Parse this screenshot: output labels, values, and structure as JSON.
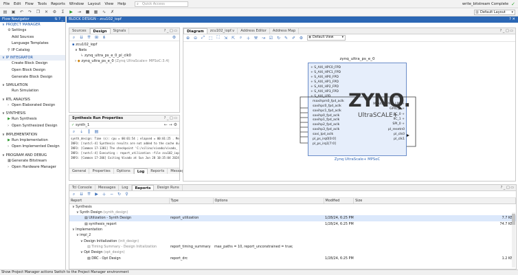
{
  "menu": {
    "items": [
      "File",
      "Edit",
      "Flow",
      "Tools",
      "Reports",
      "Window",
      "Layout",
      "View",
      "Help"
    ],
    "quick_access_placeholder": "Quick Access"
  },
  "status": {
    "right": "write_bitstream Complete"
  },
  "layout": {
    "selected": "Default Layout"
  },
  "flow_navigator": {
    "title": "Flow Navigator",
    "sections": [
      {
        "label": "PROJECT MANAGER",
        "items": [
          "Settings",
          "Add Sources",
          "Language Templates",
          "IP Catalog"
        ]
      },
      {
        "label": "IP INTEGRATOR",
        "items": [
          "Create Block Design",
          "Open Block Design",
          "Generate Block Design"
        ]
      },
      {
        "label": "SIMULATION",
        "items": [
          "Run Simulation"
        ]
      },
      {
        "label": "RTL ANALYSIS",
        "items": [
          "Open Elaborated Design"
        ]
      },
      {
        "label": "SYNTHESIS",
        "items": [
          "Run Synthesis",
          "Open Synthesized Design"
        ]
      },
      {
        "label": "IMPLEMENTATION",
        "items": [
          "Run Implementation",
          "Open Implemented Design"
        ]
      },
      {
        "label": "PROGRAM AND DEBUG",
        "items": [
          "Generate Bitstream",
          "Open Hardware Manager"
        ]
      }
    ]
  },
  "block_design": {
    "title": "BLOCK DESIGN - zcu102_iopf"
  },
  "sources_panel": {
    "tabs": [
      "Sources",
      "Design",
      "Signals"
    ],
    "root": "zcu102_iopf",
    "nets_label": "Nets",
    "nodes": [
      {
        "name": "zynq_ultra_ps_e_0_pl_clk0"
      },
      {
        "name": "zynq_ultra_ps_e_0",
        "detail": "(Zynq UltraScale+ MPSoC:3.4)"
      }
    ]
  },
  "synth_panel": {
    "title": "Synthesis Run Properties",
    "run": "synth_1",
    "log": [
      "synth_design: Time (s): cpu = 00:01:54 ; elapsed = 00:01:25 . Mem",
      "INFO: [runtcl-4] Synthesis results are not added to the cache due",
      "INFO: [Common 17-1381] The checkpoint 'C:/xilinx/vivado/vivado_",
      "INFO: [runtcl-4] Executing : report_utilization -file zcu102_iopf",
      "INFO: [Common 17-206] Exiting Vivado at Sun Jun 28 10:35:04 2024."
    ],
    "tabs": [
      "General",
      "Properties",
      "Options",
      "Log",
      "Reports",
      "Messages"
    ]
  },
  "diagram_panel": {
    "tabs": [
      "Diagram",
      "zcu102_iopf.v",
      "Address Editor",
      "Address Map"
    ],
    "view_selector": "Default View",
    "ip": {
      "name": "zynq_ultra_ps_e_0",
      "left_ports": [
        "S_AXI_HPC0_FPD",
        "S_AXI_HPC1_FPD",
        "S_AXI_HP0_FPD",
        "S_AXI_HP1_FPD",
        "S_AXI_HP2_FPD",
        "S_AXI_HP3_FPD",
        "S_AXI_LPD",
        "maxihpm0_fpd_aclk",
        "saxihpc0_fpd_aclk",
        "saxihpc1_fpd_aclk",
        "saxihp0_fpd_aclk",
        "saxihp1_fpd_aclk",
        "saxihp2_fpd_aclk",
        "saxihp3_fpd_aclk",
        "saxi_lpd_aclk",
        "pl_ps_irq0[0:0]",
        "pl_ps_irq1[7:0]"
      ],
      "right_ports": [
        "M_AXI_HPM0_LPD",
        "GPIO_0",
        "IIC_0",
        "IIC_1",
        "SPI_0",
        "pl_resetn0",
        "pl_clk0",
        "pl_clk1"
      ],
      "logo_main": "ZYNQ.",
      "logo_sub": "UltraSCALE+",
      "footer": "Zynq UltraScale+ MPSoC"
    }
  },
  "bottom_panel": {
    "tabs": [
      "Tcl Console",
      "Messages",
      "Log",
      "Reports",
      "Design Runs"
    ],
    "columns": [
      "Report",
      "Type",
      "Options",
      "Modified",
      "Size"
    ],
    "rows": [
      {
        "report": "Synthesis",
        "type": "",
        "options": "",
        "modified": "",
        "size": ""
      },
      {
        "report": "Synth Design",
        "note": "(synth_design)",
        "type": "",
        "options": "",
        "modified": "",
        "size": ""
      },
      {
        "report": "Utilization - Synth Design",
        "type": "report_utilization",
        "options": "",
        "modified": "1/28/24, 6:25 PM",
        "size": "7.7 KB"
      },
      {
        "report": "synthesis_report",
        "type": "",
        "options": "",
        "modified": "1/28/24, 6:25 PM",
        "size": "74.7 KB"
      },
      {
        "report": "Implementation",
        "type": "",
        "options": "",
        "modified": "",
        "size": ""
      },
      {
        "report": "impl_2",
        "type": "",
        "options": "",
        "modified": "",
        "size": ""
      },
      {
        "report": "Design Initialization",
        "note": "(init_design)",
        "type": "",
        "options": "",
        "modified": "",
        "size": ""
      },
      {
        "report": "Timing Summary - Design Initialization",
        "type": "report_timing_summary",
        "options": "max_paths = 10, report_unconstrained = true;",
        "modified": "",
        "size": ""
      },
      {
        "report": "Opt Design",
        "note": "(opt_design)",
        "type": "",
        "options": "",
        "modified": "",
        "size": ""
      },
      {
        "report": "DRC - Opt Design",
        "type": "report_drc",
        "options": "",
        "modified": "1/28/24, 6:25 PM",
        "size": "1.2 KB"
      }
    ]
  },
  "statusbar": {
    "text": "Show Project Manager actions Switch to the Project Manager environment"
  }
}
